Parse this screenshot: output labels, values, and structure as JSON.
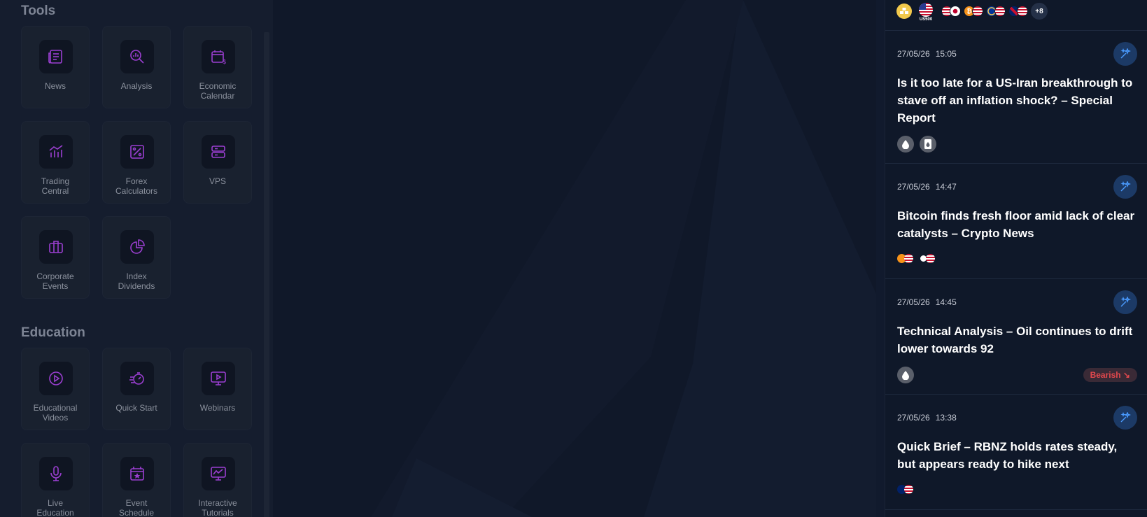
{
  "tools": {
    "title": "Tools",
    "items": [
      {
        "label": "News",
        "icon": "newspaper-icon"
      },
      {
        "label": "Analysis",
        "icon": "magnifier-chart-icon"
      },
      {
        "label": "Economic\nCalendar",
        "icon": "calendar-dollar-icon"
      },
      {
        "label": "Trading\nCentral",
        "icon": "chart-arrow-icon"
      },
      {
        "label": "Forex\nCalculators",
        "icon": "percent-calculator-icon"
      },
      {
        "label": "VPS",
        "icon": "server-icon"
      },
      {
        "label": "Corporate\nEvents",
        "icon": "briefcase-icon"
      },
      {
        "label": "Index\nDividends",
        "icon": "pie-chart-icon"
      }
    ]
  },
  "education": {
    "title": "Education",
    "items": [
      {
        "label": "Educational\nVideos",
        "icon": "play-circle-icon"
      },
      {
        "label": "Quick Start",
        "icon": "stopwatch-icon"
      },
      {
        "label": "Webinars",
        "icon": "monitor-play-icon"
      },
      {
        "label": "Live\nEducation",
        "icon": "microphone-icon"
      },
      {
        "label": "Event\nSchedule",
        "icon": "calendar-star-icon"
      },
      {
        "label": "Interactive\nTutorials",
        "icon": "monitor-chart-icon"
      }
    ]
  },
  "assets_bar": {
    "us500_label": "US500",
    "more_count": "+8"
  },
  "news": [
    {
      "date": "27/05/26",
      "time": "15:05",
      "title": "Is it too late for a US-Iran breakthrough to stave off an inflation shock? – Special Report"
    },
    {
      "date": "27/05/26",
      "time": "14:47",
      "title": "Bitcoin finds fresh floor amid lack of clear catalysts – Crypto News"
    },
    {
      "date": "27/05/26",
      "time": "14:45",
      "title": "Technical Analysis – Oil continues to drift lower towards 92",
      "sentiment": "Bearish ↘"
    },
    {
      "date": "27/05/26",
      "time": "13:38",
      "title": "Quick Brief – RBNZ holds rates steady, but appears ready to hike next"
    }
  ],
  "colors": {
    "accent_purple": "#9b3fd1",
    "ai_blue": "#2f7ee8",
    "bearish_red": "#e2484d",
    "gold": "#f2c94c",
    "bitcoin_orange": "#f7931a"
  }
}
